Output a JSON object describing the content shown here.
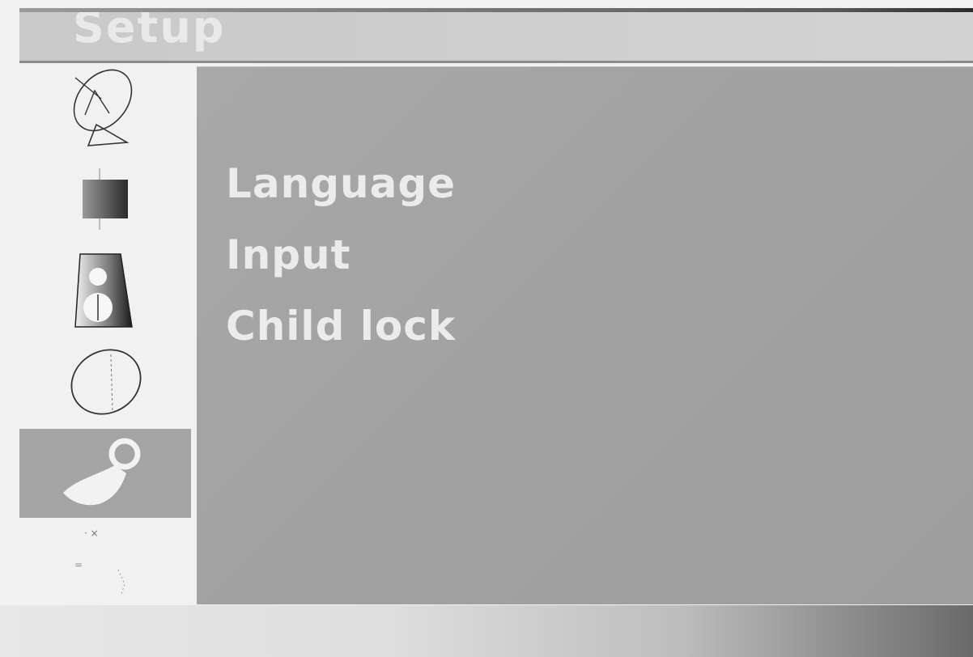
{
  "header": {
    "title": "Setup"
  },
  "sidebar": {
    "items": [
      {
        "icon": "satellite-dish-icon",
        "active": false
      },
      {
        "icon": "picture-icon",
        "active": false
      },
      {
        "icon": "sound-icon",
        "active": false
      },
      {
        "icon": "globe-icon",
        "active": false
      },
      {
        "icon": "setup-tool-icon",
        "active": true
      },
      {
        "icon": "extra-icon",
        "active": false
      },
      {
        "icon": "extra-icon-2",
        "active": false
      }
    ]
  },
  "menu": {
    "items": [
      {
        "label": "Language"
      },
      {
        "label": "Input"
      },
      {
        "label": "Child lock"
      }
    ]
  },
  "colors": {
    "panel": "#a4a4a4",
    "highlight": "#a4a4a4",
    "text": "#ebebeb"
  }
}
